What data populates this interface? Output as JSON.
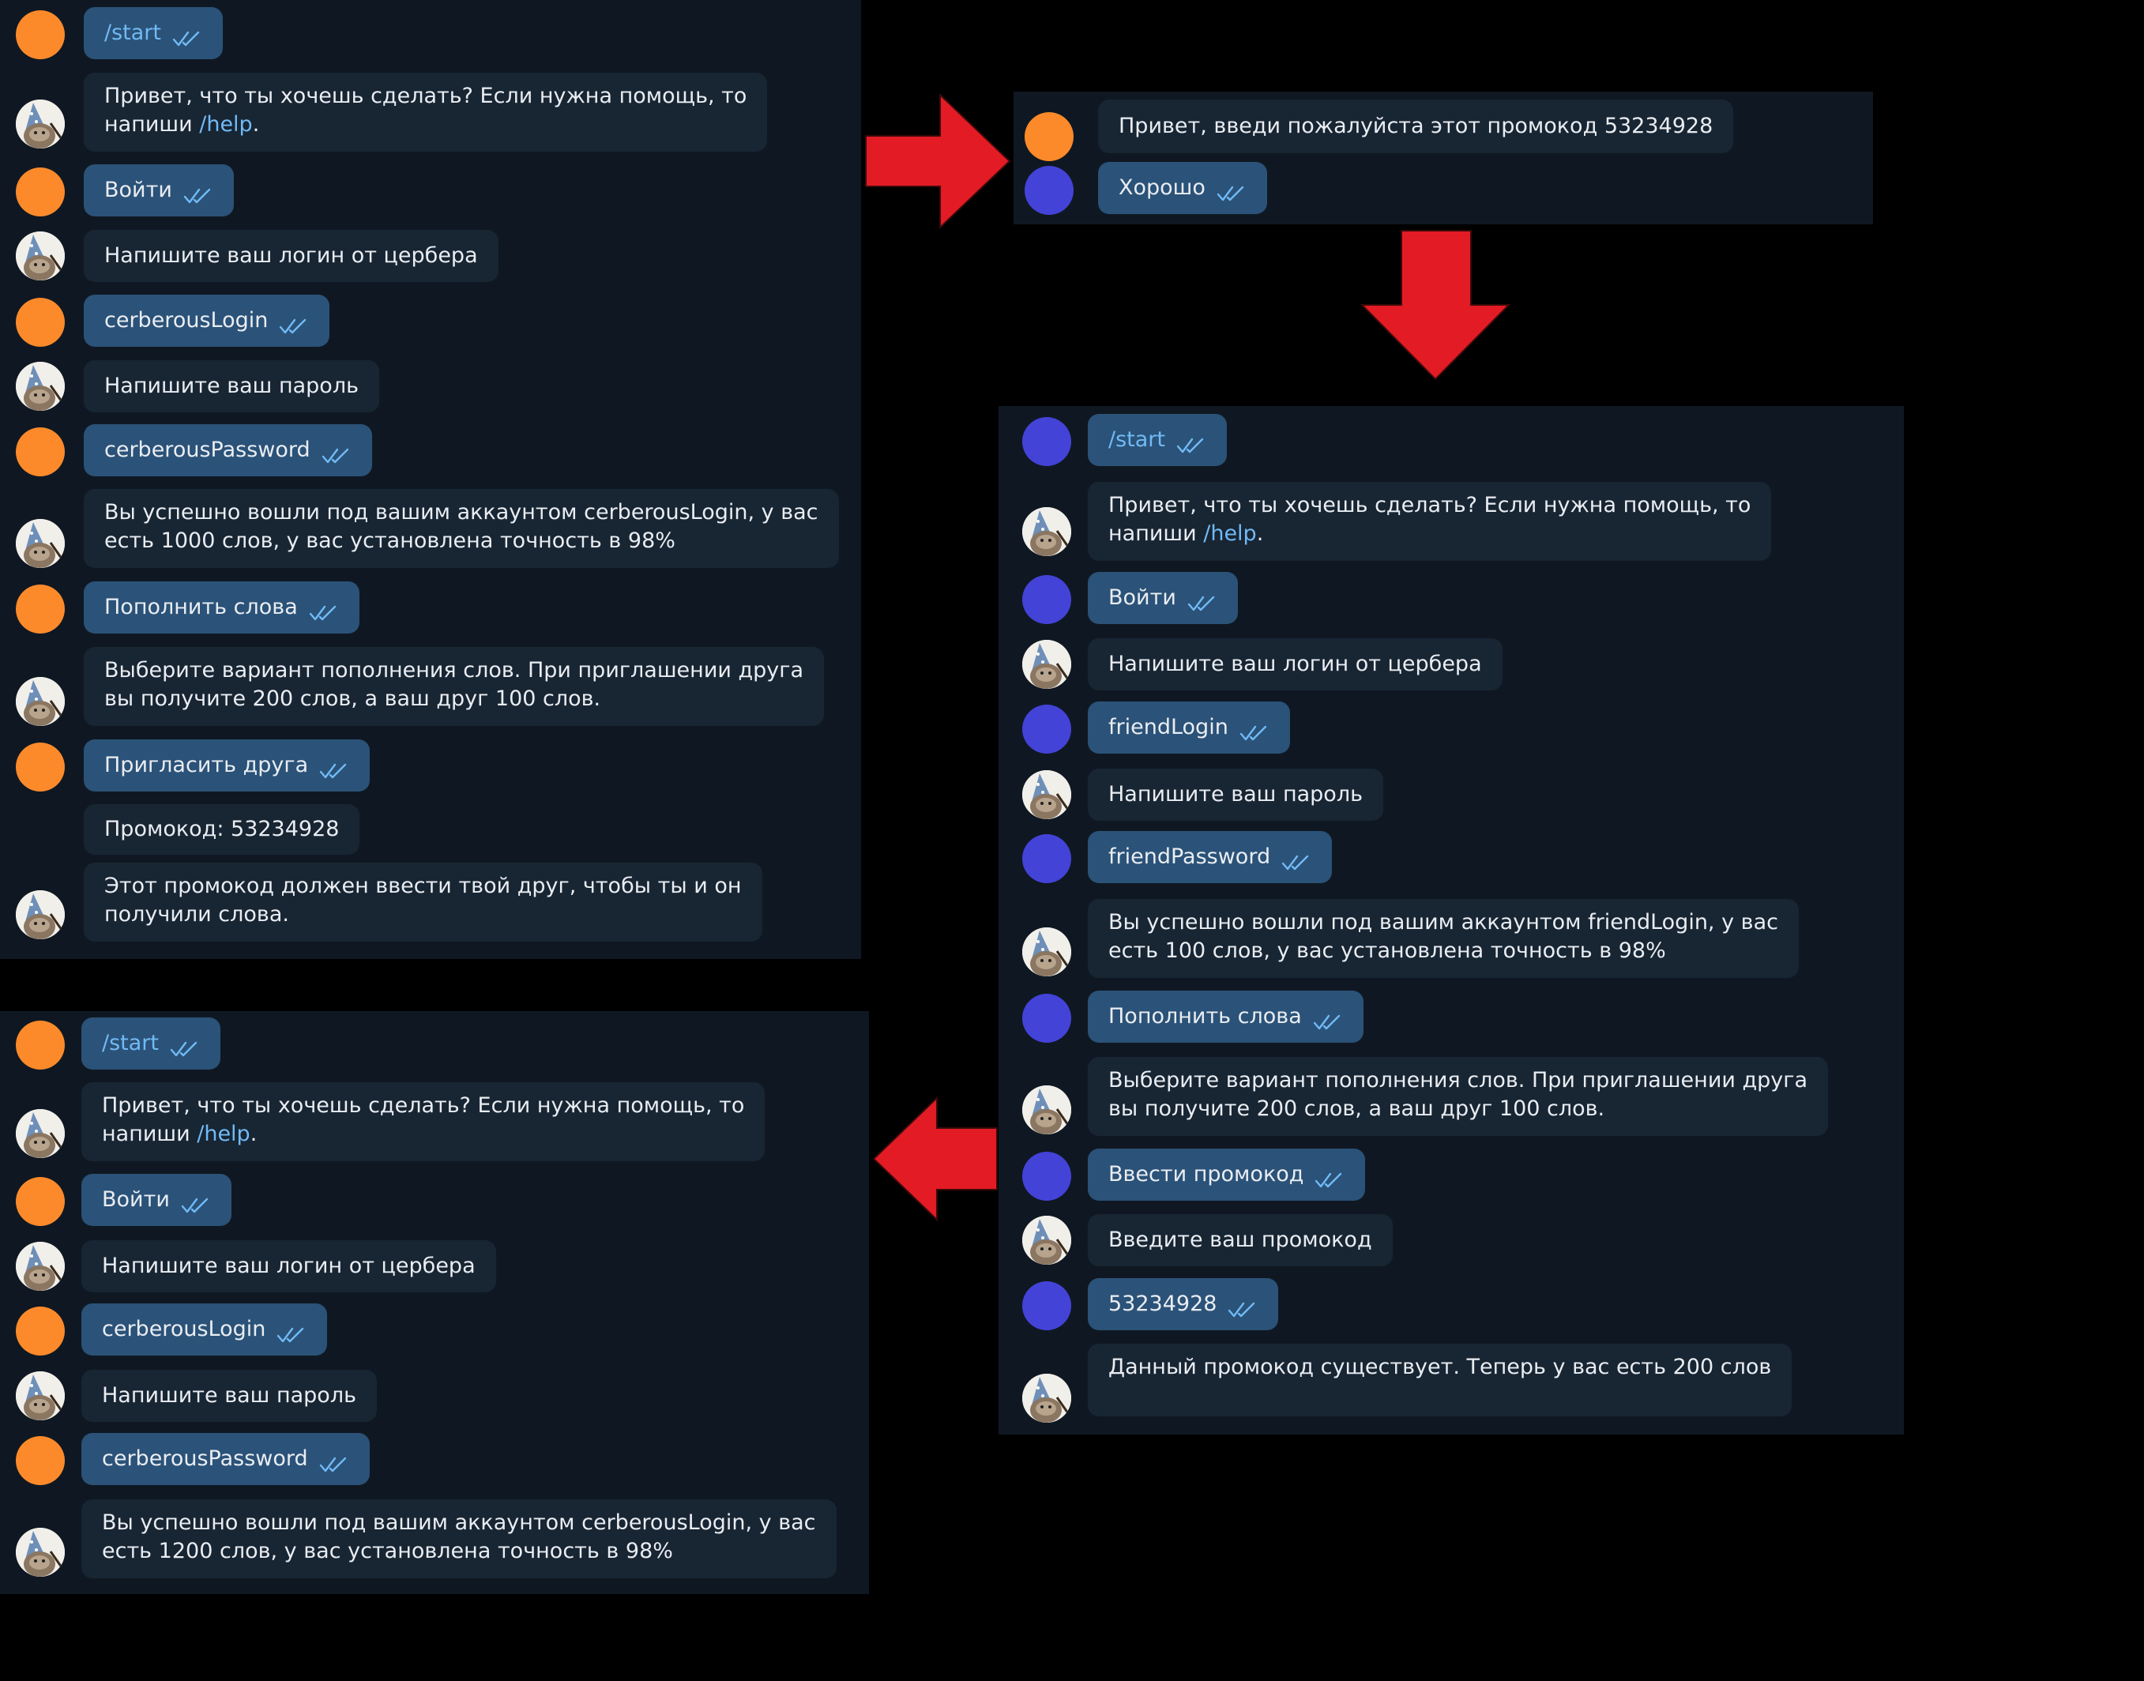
{
  "colors": {
    "panel_bg": "#0f1822",
    "bubble_in": "#182533",
    "bubble_out": "#2b5278",
    "command_link": "#71baf6",
    "avatar_orange": "#fc8a2b",
    "avatar_blue": "#4343d8",
    "arrow_red": "#e31b25"
  },
  "icons": {
    "read_receipt": "double-check-icon",
    "bot_avatar": "wizard-cat-avatar",
    "flow_arrow": "red-arrow-icon"
  },
  "chat1": {
    "messages": [
      {
        "text": "/start"
      },
      {
        "line1": "Привет, что ты хочешь сделать? Если нужна помощь, то",
        "line2_prefix": "напиши ",
        "command": "/help",
        "line2_suffix": "."
      },
      {
        "text": "Войти"
      },
      {
        "text": "Напишите ваш логин от цербера"
      },
      {
        "text": "cerberousLogin"
      },
      {
        "text": "Напишите ваш пароль"
      },
      {
        "text": "cerberousPassword"
      },
      {
        "line1": "Вы успешно вошли под вашим аккаунтом cerberousLogin, у вас",
        "line2": "есть 1000 слов, у вас установлена точность в 98%"
      },
      {
        "text": "Пополнить слова"
      },
      {
        "line1": "Выберите вариант пополнения слов. При приглашении друга",
        "line2": "вы получите 200 слов, а ваш друг 100 слов."
      },
      {
        "text": "Пригласить друга"
      },
      {
        "text": "Промокод: 53234928"
      },
      {
        "line1": "Этот промокод должен ввести твой друг, чтобы ты и он",
        "line2": "получили слова."
      }
    ]
  },
  "chat2": {
    "messages": [
      {
        "text": "Привет, введи пожалуйста этот промокод 53234928"
      },
      {
        "text": "Хорошо"
      }
    ]
  },
  "chat3": {
    "messages": [
      {
        "text": "/start"
      },
      {
        "line1": "Привет, что ты хочешь сделать? Если нужна помощь, то",
        "line2_prefix": "напиши ",
        "command": "/help",
        "line2_suffix": "."
      },
      {
        "text": "Войти"
      },
      {
        "text": "Напишите ваш логин от цербера"
      },
      {
        "text": "friendLogin"
      },
      {
        "text": "Напишите ваш пароль"
      },
      {
        "text": "friendPassword"
      },
      {
        "line1": "Вы успешно вошли под вашим аккаунтом friendLogin, у вас",
        "line2": "есть 100 слов, у вас установлена точность в 98%"
      },
      {
        "text": "Пополнить слова"
      },
      {
        "line1": "Выберите вариант пополнения слов. При приглашении друга",
        "line2": "вы получите 200 слов, а ваш друг 100 слов."
      },
      {
        "text": "Ввести промокод"
      },
      {
        "text": "Введите ваш промокод"
      },
      {
        "text": "53234928"
      },
      {
        "text": "Данный промокод существует. Теперь у вас есть 200 слов"
      }
    ]
  },
  "chat4": {
    "messages": [
      {
        "text": "/start"
      },
      {
        "line1": "Привет, что ты хочешь сделать? Если нужна помощь, то",
        "line2_prefix": "напиши ",
        "command": "/help",
        "line2_suffix": "."
      },
      {
        "text": "Войти"
      },
      {
        "text": "Напишите ваш логин от цербера"
      },
      {
        "text": "cerberousLogin"
      },
      {
        "text": "Напишите ваш пароль"
      },
      {
        "text": "cerberousPassword"
      },
      {
        "line1": "Вы успешно вошли под вашим аккаунтом cerberousLogin, у вас",
        "line2": "есть 1200 слов, у вас установлена точность в 98%"
      }
    ]
  }
}
